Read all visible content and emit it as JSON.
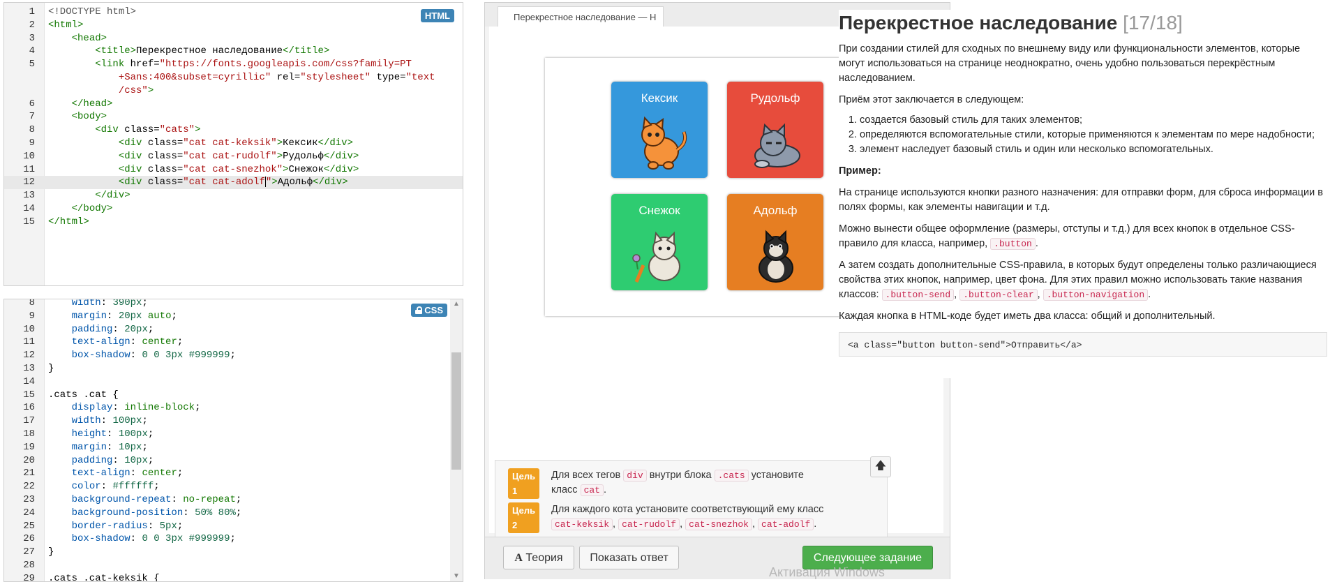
{
  "html_editor": {
    "badge": "HTML",
    "lines": [
      {
        "n": "1",
        "segs": [
          {
            "c": "t-doc",
            "t": "<!DOCTYPE html>"
          }
        ]
      },
      {
        "n": "2",
        "segs": [
          {
            "c": "t-tag",
            "t": "<html>"
          }
        ]
      },
      {
        "n": "3",
        "segs": [
          {
            "c": "",
            "t": "    "
          },
          {
            "c": "t-tag",
            "t": "<head>"
          }
        ]
      },
      {
        "n": "4",
        "segs": [
          {
            "c": "",
            "t": "        "
          },
          {
            "c": "t-tag",
            "t": "<title>"
          },
          {
            "c": "",
            "t": "Перекрестное наследование"
          },
          {
            "c": "t-tag",
            "t": "</title>"
          }
        ]
      },
      {
        "n": "5",
        "segs": [
          {
            "c": "",
            "t": "        "
          },
          {
            "c": "t-tag",
            "t": "<link "
          },
          {
            "c": "t-attr",
            "t": "href="
          },
          {
            "c": "t-str",
            "t": "\"https://fonts.googleapis.com/css?family=PT"
          }
        ]
      },
      {
        "n": "",
        "segs": [
          {
            "c": "t-str",
            "t": "            +Sans:400&subset=cyrillic\" "
          },
          {
            "c": "t-attr",
            "t": "rel="
          },
          {
            "c": "t-str",
            "t": "\"stylesheet\" "
          },
          {
            "c": "t-attr",
            "t": "type="
          },
          {
            "c": "t-str",
            "t": "\"text"
          }
        ]
      },
      {
        "n": "",
        "segs": [
          {
            "c": "t-str",
            "t": "            /css\""
          },
          {
            "c": "t-tag",
            "t": ">"
          }
        ]
      },
      {
        "n": "6",
        "segs": [
          {
            "c": "",
            "t": "    "
          },
          {
            "c": "t-tag",
            "t": "</head>"
          }
        ]
      },
      {
        "n": "7",
        "segs": [
          {
            "c": "",
            "t": "    "
          },
          {
            "c": "t-tag",
            "t": "<body>"
          }
        ]
      },
      {
        "n": "8",
        "segs": [
          {
            "c": "",
            "t": "        "
          },
          {
            "c": "t-tag",
            "t": "<div "
          },
          {
            "c": "t-attr",
            "t": "class="
          },
          {
            "c": "t-str",
            "t": "\"cats\""
          },
          {
            "c": "t-tag",
            "t": ">"
          }
        ]
      },
      {
        "n": "9",
        "segs": [
          {
            "c": "",
            "t": "            "
          },
          {
            "c": "t-tag",
            "t": "<div "
          },
          {
            "c": "t-attr",
            "t": "class="
          },
          {
            "c": "t-str",
            "t": "\"cat cat-keksik\""
          },
          {
            "c": "t-tag",
            "t": ">"
          },
          {
            "c": "",
            "t": "Кексик"
          },
          {
            "c": "t-tag",
            "t": "</div>"
          }
        ]
      },
      {
        "n": "10",
        "segs": [
          {
            "c": "",
            "t": "            "
          },
          {
            "c": "t-tag",
            "t": "<div "
          },
          {
            "c": "t-attr",
            "t": "class="
          },
          {
            "c": "t-str",
            "t": "\"cat cat-rudolf\""
          },
          {
            "c": "t-tag",
            "t": ">"
          },
          {
            "c": "",
            "t": "Рудольф"
          },
          {
            "c": "t-tag",
            "t": "</div>"
          }
        ]
      },
      {
        "n": "11",
        "segs": [
          {
            "c": "",
            "t": "            "
          },
          {
            "c": "t-tag",
            "t": "<div "
          },
          {
            "c": "t-attr",
            "t": "class="
          },
          {
            "c": "t-str",
            "t": "\"cat cat-snezhok\""
          },
          {
            "c": "t-tag",
            "t": ">"
          },
          {
            "c": "",
            "t": "Снежок"
          },
          {
            "c": "t-tag",
            "t": "</div>"
          }
        ]
      },
      {
        "n": "12",
        "active": true,
        "segs": [
          {
            "c": "",
            "t": "            "
          },
          {
            "c": "t-tag",
            "t": "<div "
          },
          {
            "c": "t-attr",
            "t": "class="
          },
          {
            "c": "t-str",
            "t": "\"cat cat-adolf"
          },
          {
            "c": "caret",
            "t": ""
          },
          {
            "c": "t-str",
            "t": "\""
          },
          {
            "c": "t-tag",
            "t": ">"
          },
          {
            "c": "",
            "t": "Адольф"
          },
          {
            "c": "t-tag",
            "t": "</div>"
          }
        ]
      },
      {
        "n": "13",
        "segs": [
          {
            "c": "",
            "t": "        "
          },
          {
            "c": "t-tag",
            "t": "</div>"
          }
        ]
      },
      {
        "n": "14",
        "segs": [
          {
            "c": "",
            "t": "    "
          },
          {
            "c": "t-tag",
            "t": "</body>"
          }
        ]
      },
      {
        "n": "15",
        "segs": [
          {
            "c": "t-tag",
            "t": "</html>"
          }
        ]
      }
    ]
  },
  "css_editor": {
    "badge": "CSS",
    "lines": [
      {
        "n": "8",
        "segs": [
          {
            "c": "",
            "t": "    "
          },
          {
            "c": "c-prop",
            "t": "width"
          },
          {
            "c": "",
            "t": ": "
          },
          {
            "c": "c-num",
            "t": "390px"
          },
          {
            "c": "",
            "t": ";"
          }
        ]
      },
      {
        "n": "9",
        "segs": [
          {
            "c": "",
            "t": "    "
          },
          {
            "c": "c-prop",
            "t": "margin"
          },
          {
            "c": "",
            "t": ": "
          },
          {
            "c": "c-num",
            "t": "20px"
          },
          {
            "c": "",
            "t": " "
          },
          {
            "c": "c-val",
            "t": "auto"
          },
          {
            "c": "",
            "t": ";"
          }
        ]
      },
      {
        "n": "10",
        "segs": [
          {
            "c": "",
            "t": "    "
          },
          {
            "c": "c-prop",
            "t": "padding"
          },
          {
            "c": "",
            "t": ": "
          },
          {
            "c": "c-num",
            "t": "20px"
          },
          {
            "c": "",
            "t": ";"
          }
        ]
      },
      {
        "n": "11",
        "segs": [
          {
            "c": "",
            "t": "    "
          },
          {
            "c": "c-prop",
            "t": "text-align"
          },
          {
            "c": "",
            "t": ": "
          },
          {
            "c": "c-val",
            "t": "center"
          },
          {
            "c": "",
            "t": ";"
          }
        ]
      },
      {
        "n": "12",
        "segs": [
          {
            "c": "",
            "t": "    "
          },
          {
            "c": "c-prop",
            "t": "box-shadow"
          },
          {
            "c": "",
            "t": ": "
          },
          {
            "c": "c-num",
            "t": "0 0 3px"
          },
          {
            "c": "",
            "t": " "
          },
          {
            "c": "c-col",
            "t": "#999999"
          },
          {
            "c": "",
            "t": ";"
          }
        ]
      },
      {
        "n": "13",
        "segs": [
          {
            "c": "",
            "t": "}"
          }
        ]
      },
      {
        "n": "14",
        "segs": [
          {
            "c": "",
            "t": ""
          }
        ]
      },
      {
        "n": "15",
        "segs": [
          {
            "c": "c-sel",
            "t": ".cats .cat"
          },
          {
            "c": "",
            "t": " {"
          }
        ]
      },
      {
        "n": "16",
        "segs": [
          {
            "c": "",
            "t": "    "
          },
          {
            "c": "c-prop",
            "t": "display"
          },
          {
            "c": "",
            "t": ": "
          },
          {
            "c": "c-val",
            "t": "inline-block"
          },
          {
            "c": "",
            "t": ";"
          }
        ]
      },
      {
        "n": "17",
        "segs": [
          {
            "c": "",
            "t": "    "
          },
          {
            "c": "c-prop",
            "t": "width"
          },
          {
            "c": "",
            "t": ": "
          },
          {
            "c": "c-num",
            "t": "100px"
          },
          {
            "c": "",
            "t": ";"
          }
        ]
      },
      {
        "n": "18",
        "segs": [
          {
            "c": "",
            "t": "    "
          },
          {
            "c": "c-prop",
            "t": "height"
          },
          {
            "c": "",
            "t": ": "
          },
          {
            "c": "c-num",
            "t": "100px"
          },
          {
            "c": "",
            "t": ";"
          }
        ]
      },
      {
        "n": "19",
        "segs": [
          {
            "c": "",
            "t": "    "
          },
          {
            "c": "c-prop",
            "t": "margin"
          },
          {
            "c": "",
            "t": ": "
          },
          {
            "c": "c-num",
            "t": "10px"
          },
          {
            "c": "",
            "t": ";"
          }
        ]
      },
      {
        "n": "20",
        "segs": [
          {
            "c": "",
            "t": "    "
          },
          {
            "c": "c-prop",
            "t": "padding"
          },
          {
            "c": "",
            "t": ": "
          },
          {
            "c": "c-num",
            "t": "10px"
          },
          {
            "c": "",
            "t": ";"
          }
        ]
      },
      {
        "n": "21",
        "segs": [
          {
            "c": "",
            "t": "    "
          },
          {
            "c": "c-prop",
            "t": "text-align"
          },
          {
            "c": "",
            "t": ": "
          },
          {
            "c": "c-val",
            "t": "center"
          },
          {
            "c": "",
            "t": ";"
          }
        ]
      },
      {
        "n": "22",
        "segs": [
          {
            "c": "",
            "t": "    "
          },
          {
            "c": "c-prop",
            "t": "color"
          },
          {
            "c": "",
            "t": ": "
          },
          {
            "c": "c-col",
            "t": "#ffffff"
          },
          {
            "c": "",
            "t": ";"
          }
        ]
      },
      {
        "n": "23",
        "segs": [
          {
            "c": "",
            "t": "    "
          },
          {
            "c": "c-prop",
            "t": "background-repeat"
          },
          {
            "c": "",
            "t": ": "
          },
          {
            "c": "c-val",
            "t": "no-repeat"
          },
          {
            "c": "",
            "t": ";"
          }
        ]
      },
      {
        "n": "24",
        "segs": [
          {
            "c": "",
            "t": "    "
          },
          {
            "c": "c-prop",
            "t": "background-position"
          },
          {
            "c": "",
            "t": ": "
          },
          {
            "c": "c-num",
            "t": "50% 80%"
          },
          {
            "c": "",
            "t": ";"
          }
        ]
      },
      {
        "n": "25",
        "segs": [
          {
            "c": "",
            "t": "    "
          },
          {
            "c": "c-prop",
            "t": "border-radius"
          },
          {
            "c": "",
            "t": ": "
          },
          {
            "c": "c-num",
            "t": "5px"
          },
          {
            "c": "",
            "t": ";"
          }
        ]
      },
      {
        "n": "26",
        "segs": [
          {
            "c": "",
            "t": "    "
          },
          {
            "c": "c-prop",
            "t": "box-shadow"
          },
          {
            "c": "",
            "t": ": "
          },
          {
            "c": "c-num",
            "t": "0 0 3px"
          },
          {
            "c": "",
            "t": " "
          },
          {
            "c": "c-col",
            "t": "#999999"
          },
          {
            "c": "",
            "t": ";"
          }
        ]
      },
      {
        "n": "27",
        "segs": [
          {
            "c": "",
            "t": "}"
          }
        ]
      },
      {
        "n": "28",
        "segs": [
          {
            "c": "",
            "t": ""
          }
        ]
      },
      {
        "n": "29",
        "segs": [
          {
            "c": "c-sel",
            "t": ".cats .cat-keksik"
          },
          {
            "c": "",
            "t": " {"
          }
        ]
      }
    ]
  },
  "preview": {
    "tab_title": "Перекрестное наследование — Н",
    "cats": [
      {
        "name": "Кексик",
        "color": "#3598dc",
        "icon": "orange-cat-icon"
      },
      {
        "name": "Рудольф",
        "color": "#e74c3c",
        "icon": "gray-cat-icon"
      },
      {
        "name": "Снежок",
        "color": "#2ecc71",
        "icon": "white-cat-icon"
      },
      {
        "name": "Адольф",
        "color": "#e67e22",
        "icon": "black-cat-icon"
      }
    ],
    "goals": [
      {
        "label": "Цель 1",
        "parts": [
          {
            "t": "Для всех тегов "
          },
          {
            "code": "div"
          },
          {
            "t": " внутри блока "
          },
          {
            "code": ".cats"
          },
          {
            "t": " установите"
          },
          {
            "br": true
          },
          {
            "t": "класс "
          },
          {
            "code": "cat"
          },
          {
            "t": "."
          }
        ]
      },
      {
        "label": "Цель 2",
        "parts": [
          {
            "t": "Для каждого кота установите соответствующий ему класс"
          },
          {
            "br": true
          },
          {
            "code": "cat-keksik"
          },
          {
            "t": ", "
          },
          {
            "code": "cat-rudolf"
          },
          {
            "t": ", "
          },
          {
            "code": "cat-snezhok"
          },
          {
            "t": ", "
          },
          {
            "code": "cat-adolf"
          },
          {
            "t": "."
          }
        ]
      }
    ],
    "up_icon": "arrow-up-icon",
    "theory_button": "Теория",
    "answer_button": "Показать ответ",
    "next_button": "Следующее задание",
    "watermark": "Активация Windows"
  },
  "theory": {
    "title": "Перекрестное наследование",
    "counter": "[17/18]",
    "intro": "При создании стилей для сходных по внешнему виду или функциональности элементов, которые могут использоваться на странице неоднократно, очень удобно пользоваться перекрёстным наследованием.",
    "method": "Приём этот заключается в следующем:",
    "steps": [
      "создается базовый стиль для таких элементов;",
      "определяются вспомогательные стили, которые применяются к элементам по мере надобности;",
      "элемент наследует базовый стиль и один или несколько вспомогательных."
    ],
    "example_heading": "Пример:",
    "p1": "На странице используются кнопки разного назначения: для отправки форм, для сброса информации в полях формы, как элементы навигации и т.д.",
    "p2_parts": [
      {
        "t": "Можно вынести общее оформление (размеры, отступы и т.д.) для всех кнопок в отдельное CSS-правило для класса, например, "
      },
      {
        "code": ".button"
      },
      {
        "t": "."
      }
    ],
    "p3_parts": [
      {
        "t": "А затем создать дополнительные CSS-правила, в которых будут определены только различающиеся свойства этих кнопок, например, цвет фона. Для этих правил можно использовать такие названия классов: "
      },
      {
        "code": ".button-send"
      },
      {
        "t": ", "
      },
      {
        "code": ".button-clear"
      },
      {
        "t": ", "
      },
      {
        "code": ".button-navigation"
      },
      {
        "t": "."
      }
    ],
    "p4": "Каждая кнопка в HTML-коде будет иметь два класса: общий и дополнительный.",
    "code_example": "<a class=\"button button-send\">Отправить</a>"
  }
}
